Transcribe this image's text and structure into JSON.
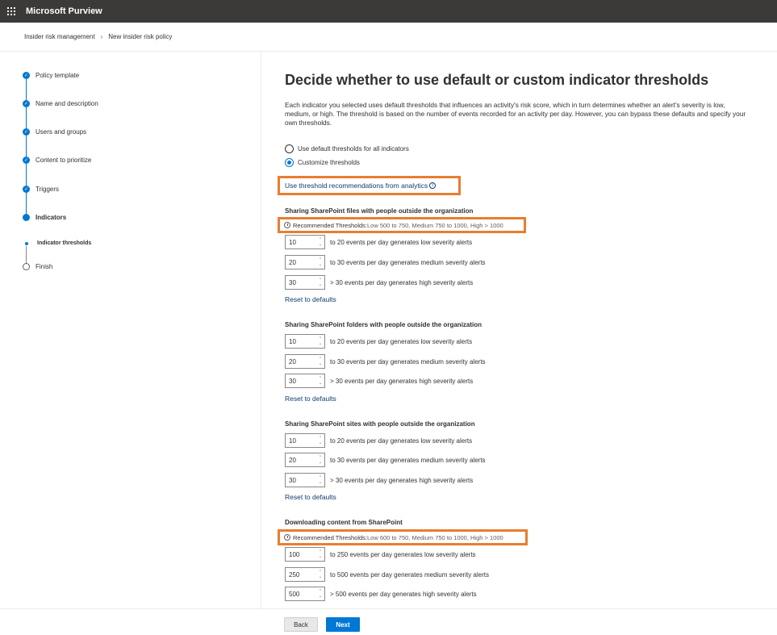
{
  "app": {
    "title": "Microsoft Purview"
  },
  "breadcrumb": {
    "items": [
      "Insider risk management",
      "New insider risk policy"
    ]
  },
  "steps": [
    {
      "label": "Policy template",
      "state": "done"
    },
    {
      "label": "Name and description",
      "state": "done"
    },
    {
      "label": "Users and groups",
      "state": "done"
    },
    {
      "label": "Content to prioritize",
      "state": "done"
    },
    {
      "label": "Triggers",
      "state": "done"
    },
    {
      "label": "Indicators",
      "state": "current"
    },
    {
      "label": "Indicator thresholds",
      "state": "current-sub"
    },
    {
      "label": "Finish",
      "state": "pending"
    }
  ],
  "main": {
    "heading": "Decide whether to use default or custom indicator thresholds",
    "description": "Each indicator you selected uses default thresholds that influences an activity's risk score, which in turn determines whether an alert's severity is low, medium, or high. The threshold is based on the number of events recorded for an activity per day. However, you can bypass these defaults and specify your own thresholds.",
    "options": [
      {
        "label": "Use default thresholds for all indicators",
        "selected": false
      },
      {
        "label": "Customize thresholds",
        "selected": true
      }
    ],
    "recommendation_link": "Use threshold recommendations from analytics",
    "reset_label": "Reset to defaults",
    "sections": [
      {
        "title": "Sharing SharePoint files with people outside the organization",
        "recommended": {
          "label": "Recommended Thresholds:",
          "value": "Low 500 to 750, Medium 750 to 1000, High > 1000"
        },
        "rows": [
          {
            "value": "10",
            "text": "to 20 events per day generates low severity alerts"
          },
          {
            "value": "20",
            "text": "to 30 events per day generates medium severity alerts"
          },
          {
            "value": "30",
            "text": "> 30 events per day generates high severity alerts"
          }
        ]
      },
      {
        "title": "Sharing SharePoint folders with people outside the organization",
        "rows": [
          {
            "value": "10",
            "text": "to 20 events per day generates low severity alerts"
          },
          {
            "value": "20",
            "text": "to 30 events per day generates medium severity alerts"
          },
          {
            "value": "30",
            "text": "> 30 events per day generates high severity alerts"
          }
        ]
      },
      {
        "title": "Sharing SharePoint sites with people outside the organization",
        "rows": [
          {
            "value": "10",
            "text": "to 20 events per day generates low severity alerts"
          },
          {
            "value": "20",
            "text": "to 30 events per day generates medium severity alerts"
          },
          {
            "value": "30",
            "text": "> 30 events per day generates high severity alerts"
          }
        ]
      },
      {
        "title": "Downloading content from SharePoint",
        "recommended": {
          "label": "Recommended Thresholds:",
          "value": "Low 600 to 750, Medium 750 to 1000, High > 1000"
        },
        "rows": [
          {
            "value": "100",
            "text": "to 250 events per day generates low severity alerts"
          },
          {
            "value": "250",
            "text": "to 500 events per day generates medium severity alerts"
          },
          {
            "value": "500",
            "text": "> 500 events per day generates high severity alerts"
          }
        ]
      }
    ]
  },
  "footer": {
    "back_label": "Back",
    "next_label": "Next"
  },
  "colors": {
    "accent": "#0078d4",
    "highlight": "#e97d2f",
    "topbar": "#3b3a39"
  }
}
